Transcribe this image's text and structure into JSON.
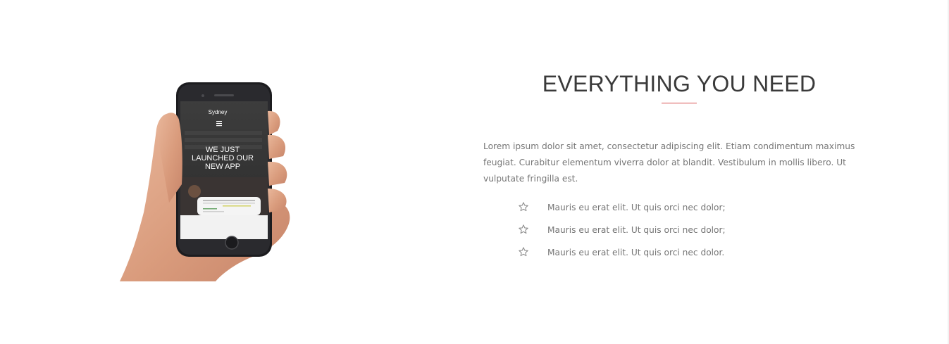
{
  "section": {
    "title": "EVERYTHING YOU NEED",
    "intro": "Lorem ipsum dolor sit amet, consectetur adipiscing elit. Etiam condimentum maximus feugiat. Curabitur elementum viverra dolor at blandit. Vestibulum in mollis libero. Ut vulputate fringilla est.",
    "features": [
      {
        "icon": "star-outline-icon",
        "text": "Mauris eu erat elit. Ut quis orci nec dolor;"
      },
      {
        "icon": "star-outline-icon",
        "text": "Mauris eu erat elit. Ut quis orci nec dolor;"
      },
      {
        "icon": "star-outline-icon",
        "text": "Mauris eu erat elit. Ut quis orci nec dolor."
      }
    ]
  },
  "phone_screen": {
    "brand": "Sydney",
    "menu_icon": "hamburger-icon",
    "headline": [
      "WE JUST",
      "LAUNCHED OUR",
      "NEW APP"
    ]
  },
  "colors": {
    "title": "#3a3a3a",
    "accent": "#d65050",
    "body_text": "#767676",
    "icon": "#8a8a8a"
  }
}
